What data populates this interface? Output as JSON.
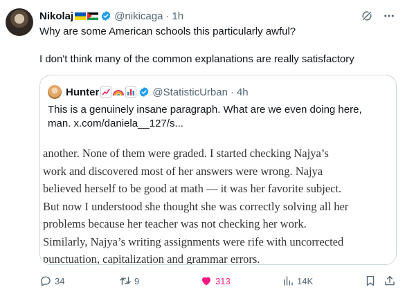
{
  "tweet": {
    "author_name": "Nikolaj",
    "flags": [
      "ukraine-flag",
      "palestine-flag"
    ],
    "handle": "@nikicaga",
    "separator": "·",
    "time": "1h",
    "text_line_1": "Why are some American schools this particularly awful?",
    "text_line_2": "I don't think many of the common explanations are really satisfactory"
  },
  "quote": {
    "author_name": "Hunter",
    "emojis": [
      "chart-increasing-emoji",
      "rainbow-emoji",
      "bar-chart-emoji"
    ],
    "handle": "@StatisticUrban",
    "separator": "·",
    "time": "4h",
    "text_line_1": "This is a genuinely insane paragraph. What are we even doing here,",
    "text_line_2": "man.  x.com/daniela__127/s...",
    "article_lines": [
      "another. None of them were graded. I started checking Najya’s",
      "work and discovered most of her answers were wrong. Najya",
      "believed herself to be good at math — it was her favorite subject.",
      "But now I understood she thought she was correctly solving all her",
      "problems because her teacher was not checking her work.",
      "Similarly, Najya’s writing assignments were rife with uncorrected",
      "punctuation, capitalization and grammar errors."
    ]
  },
  "actions": {
    "replies": "34",
    "reposts": "9",
    "likes": "313",
    "views": "14K"
  },
  "colors": {
    "verified": "#1d9bf0",
    "like": "#f91880",
    "secondary_text": "#536471",
    "border": "#cfd9de"
  },
  "icons": [
    "verified-badge-icon",
    "grok-icon",
    "more-icon",
    "reply-icon",
    "repost-icon",
    "like-icon",
    "views-icon",
    "bookmark-icon",
    "share-icon"
  ]
}
